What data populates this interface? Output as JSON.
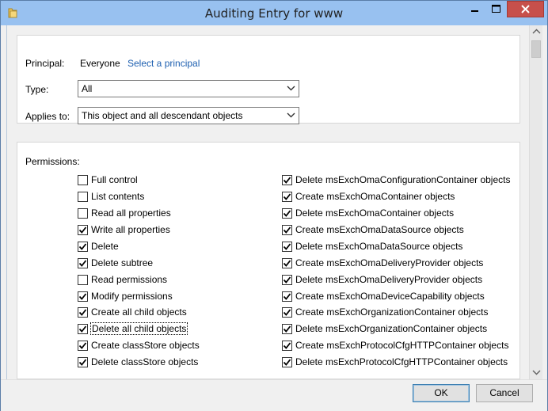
{
  "window": {
    "title": "Auditing Entry for www",
    "title_icon": "folder-icon"
  },
  "principal": {
    "label": "Principal:",
    "value": "Everyone",
    "link": "Select a principal"
  },
  "type": {
    "label": "Type:",
    "value": "All"
  },
  "applies_to": {
    "label": "Applies to:",
    "value": "This object and all descendant objects"
  },
  "permissions": {
    "label": "Permissions:",
    "left": [
      {
        "label": "Full control",
        "checked": false
      },
      {
        "label": "List contents",
        "checked": false
      },
      {
        "label": "Read all properties",
        "checked": false
      },
      {
        "label": "Write all properties",
        "checked": true
      },
      {
        "label": "Delete",
        "checked": true
      },
      {
        "label": "Delete subtree",
        "checked": true
      },
      {
        "label": "Read permissions",
        "checked": false
      },
      {
        "label": "Modify permissions",
        "checked": true
      },
      {
        "label": "Create all child objects",
        "checked": true
      },
      {
        "label": "Delete all child objects",
        "checked": true
      },
      {
        "label": "Create classStore objects",
        "checked": true
      },
      {
        "label": "Delete classStore objects",
        "checked": true
      }
    ],
    "right": [
      {
        "label": "Delete msExchOmaConfigurationContainer objects",
        "checked": true
      },
      {
        "label": "Create msExchOmaContainer objects",
        "checked": true
      },
      {
        "label": "Delete msExchOmaContainer objects",
        "checked": true
      },
      {
        "label": "Create msExchOmaDataSource objects",
        "checked": true
      },
      {
        "label": "Delete msExchOmaDataSource objects",
        "checked": true
      },
      {
        "label": "Create msExchOmaDeliveryProvider objects",
        "checked": true
      },
      {
        "label": "Delete msExchOmaDeliveryProvider objects",
        "checked": true
      },
      {
        "label": "Create msExchOmaDeviceCapability objects",
        "checked": true
      },
      {
        "label": "Create msExchOrganizationContainer objects",
        "checked": true
      },
      {
        "label": "Delete msExchOrganizationContainer objects",
        "checked": true
      },
      {
        "label": "Create msExchProtocolCfgHTTPContainer objects",
        "checked": true
      },
      {
        "label": "Delete msExchProtocolCfgHTTPContainer objects",
        "checked": true
      }
    ]
  },
  "footer": {
    "ok_label": "OK",
    "cancel_label": "Cancel"
  },
  "colors": {
    "titlebar": "#98c1f0",
    "close_button": "#c7504b",
    "link": "#1d5fb0"
  }
}
